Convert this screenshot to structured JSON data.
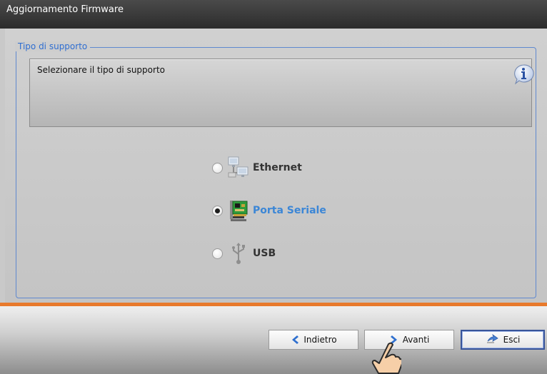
{
  "window": {
    "title": "Aggiornamento Firmware"
  },
  "group": {
    "legend": "Tipo di supporto"
  },
  "info": {
    "text": "Selezionare il tipo di supporto",
    "icon": "info-icon"
  },
  "options": [
    {
      "label": "Ethernet",
      "icon": "ethernet-network-icon",
      "selected": false
    },
    {
      "label": "Porta Seriale",
      "icon": "serial-port-card-icon",
      "selected": true
    },
    {
      "label": "USB",
      "icon": "usb-icon",
      "selected": false
    }
  ],
  "buttons": {
    "back": {
      "label": "Indietro",
      "icon": "arrow-left-icon"
    },
    "next": {
      "label": "Avanti",
      "icon": "arrow-right-icon"
    },
    "exit": {
      "label": "Esci",
      "icon": "exit-icon"
    }
  },
  "colors": {
    "accent_blue": "#2f6ed1",
    "selected_label": "#3b86d6",
    "separator": "#e87a2c",
    "titlebar": "#333333"
  }
}
